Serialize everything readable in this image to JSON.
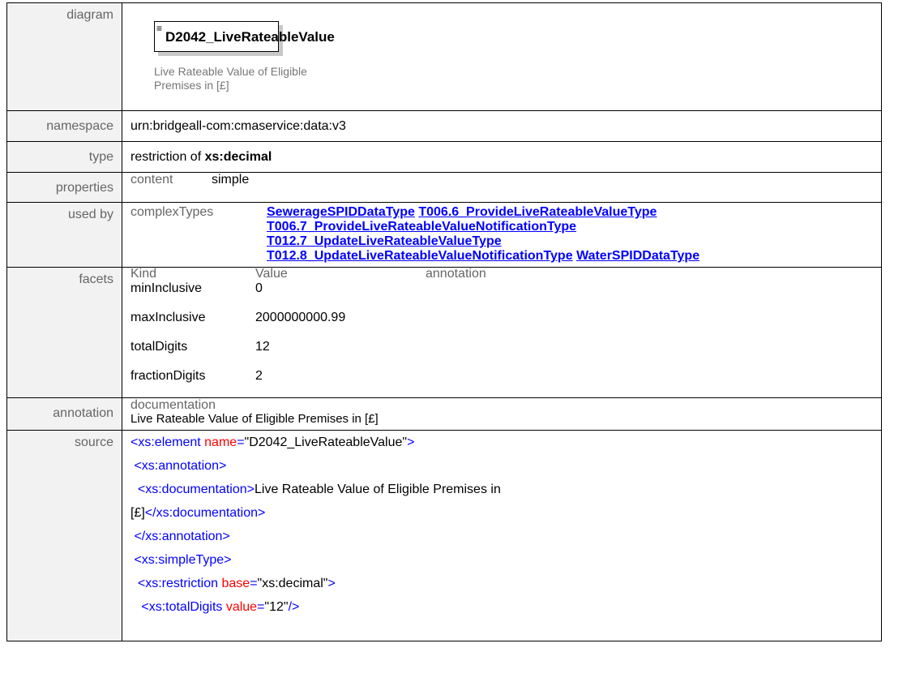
{
  "rows": {
    "diagram": {
      "label": "diagram",
      "element_name": "D2042_LiveRateableValue",
      "doc_line1": "Live Rateable Value of Eligible",
      "doc_line2": "Premises in [£]"
    },
    "namespace": {
      "label": "namespace",
      "value": "urn:bridgeall-com:cmaservice:data:v3"
    },
    "type": {
      "label": "type",
      "prefix": "restriction of ",
      "base": "xs:decimal"
    },
    "properties": {
      "label": "properties",
      "key": "content",
      "value": "simple"
    },
    "used_by": {
      "label": "used by",
      "key": "complexTypes",
      "links": [
        "SewerageSPIDDataType",
        "T006.6_ProvideLiveRateableValueType",
        "T006.7_ProvideLiveRateableValueNotificationType",
        "T012.7_UpdateLiveRateableValueType",
        "T012.8_UpdateLiveRateableValueNotificationType",
        "WaterSPIDDataType"
      ]
    },
    "facets": {
      "label": "facets",
      "headers": [
        "Kind",
        "Value",
        "annotation"
      ],
      "items": [
        {
          "kind": "minInclusive",
          "value": "0"
        },
        {
          "kind": "maxInclusive",
          "value": "2000000000.99"
        },
        {
          "kind": "totalDigits",
          "value": "12"
        },
        {
          "kind": "fractionDigits",
          "value": "2"
        }
      ]
    },
    "annotation": {
      "label": "annotation",
      "key": "documentation",
      "text": "Live Rateable Value of Eligible Premises in [£]"
    },
    "source": {
      "label": "source",
      "lines": [
        [
          {
            "c": "tag",
            "t": "<xs:element "
          },
          {
            "c": "attr",
            "t": "name"
          },
          {
            "c": "tag",
            "t": "="
          },
          {
            "c": "txt",
            "t": "\"D2042_LiveRateableValue\""
          },
          {
            "c": "tag",
            "t": ">"
          }
        ],
        [
          {
            "c": "txt",
            "t": " "
          },
          {
            "c": "tag",
            "t": "<xs:annotation>"
          }
        ],
        [
          {
            "c": "txt",
            "t": "  "
          },
          {
            "c": "tag",
            "t": "<xs:documentation>"
          },
          {
            "c": "txt",
            "t": "Live Rateable Value of Eligible Premises in"
          }
        ],
        [
          {
            "c": "txt",
            "t": "[£]"
          },
          {
            "c": "tag",
            "t": "</xs:documentation>"
          }
        ],
        [
          {
            "c": "txt",
            "t": " "
          },
          {
            "c": "tag",
            "t": "</xs:annotation>"
          }
        ],
        [
          {
            "c": "txt",
            "t": " "
          },
          {
            "c": "tag",
            "t": "<xs:simpleType>"
          }
        ],
        [
          {
            "c": "txt",
            "t": "  "
          },
          {
            "c": "tag",
            "t": "<xs:restriction "
          },
          {
            "c": "attr",
            "t": "base"
          },
          {
            "c": "tag",
            "t": "="
          },
          {
            "c": "txt",
            "t": "\"xs:decimal\""
          },
          {
            "c": "tag",
            "t": ">"
          }
        ],
        [
          {
            "c": "txt",
            "t": "   "
          },
          {
            "c": "tag",
            "t": "<xs:totalDigits "
          },
          {
            "c": "attr",
            "t": "value"
          },
          {
            "c": "tag",
            "t": "="
          },
          {
            "c": "txt",
            "t": "\"12\""
          },
          {
            "c": "tag",
            "t": "/>"
          }
        ]
      ]
    }
  }
}
